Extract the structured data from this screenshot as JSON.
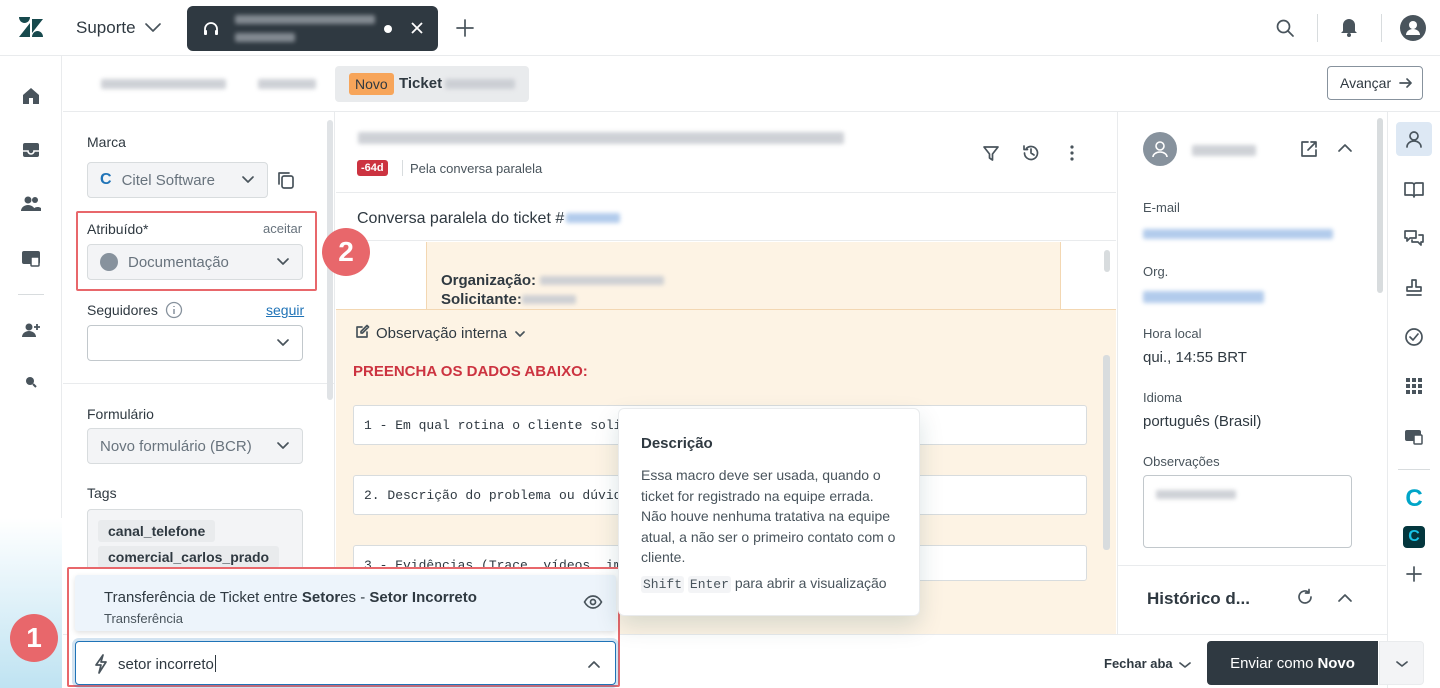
{
  "topbar": {
    "workspace": "Suporte",
    "icons": [
      "zendesk-logo-icon",
      "chevron-down-icon",
      "headset-icon",
      "close-icon",
      "plus-icon",
      "search-icon",
      "bell-icon",
      "user-icon"
    ]
  },
  "tabs": {
    "ticket_badge": "Novo",
    "ticket_label": "Ticket",
    "advance_button": "Avançar"
  },
  "left_panel": {
    "brand_label": "Marca",
    "brand_value": "Citel Software",
    "assigned_label": "Atribuído*",
    "accept_link": "aceitar",
    "assigned_value": "Documentação",
    "followers_label": "Seguidores",
    "follow_link": "seguir",
    "form_label": "Formulário",
    "form_value": "Novo formulário (BCR)",
    "tags_label": "Tags",
    "tags": [
      "canal_telefone",
      "comercial_carlos_prado"
    ]
  },
  "center": {
    "age_badge": "-64d",
    "channel": "Pela conversa paralela",
    "side_conv": "Conversa paralela do ticket #",
    "org_label": "Organização:",
    "requester_label": "Solicitante:",
    "note_type": "Observação interna",
    "fill_heading": "PREENCHA OS DADOS ABAIXO:",
    "line1": "1 - Em qual rotina o cliente solic",
    "line2": "2. Descrição do problema ou dúvida",
    "line3": "3 - Evidências (Trace, vídeos, ima"
  },
  "tooltip": {
    "title": "Descrição",
    "text": "Essa macro deve ser usada, quando o ticket for registrado na equipe errada. Não houve nenhuma tratativa na equipe atual, a não ser o primeiro contato com o cliente.",
    "key1": "Shift",
    "key2": "Enter",
    "hint": "para abrir a visualização"
  },
  "macro": {
    "title_a": "Transferência de Ticket entre ",
    "title_b": "Setor",
    "title_c": "es - ",
    "title_d": "Setor Incorreto",
    "subtitle": "Transferência",
    "search_value": "setor incorreto"
  },
  "right_panel": {
    "email_label": "E-mail",
    "org_label": "Org.",
    "local_time_label": "Hora local",
    "local_time_value": "qui., 14:55 BRT",
    "language_label": "Idioma",
    "language_value": "português (Brasil)",
    "notes_label": "Observações",
    "history_label": "Histórico d..."
  },
  "bottom": {
    "close_tab": "Fechar aba",
    "submit_prefix": "Enviar como ",
    "submit_status": "Novo"
  },
  "annotations": {
    "marker1": "1",
    "marker2": "2",
    "color": "#e8676b"
  }
}
